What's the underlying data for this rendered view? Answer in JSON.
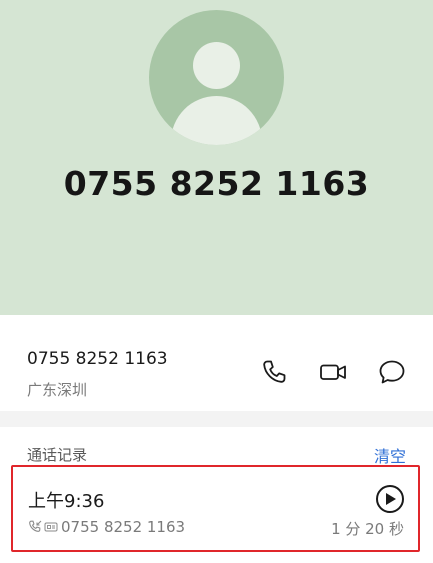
{
  "contact": {
    "number": "0755 8252 1163",
    "location": "广东深圳"
  },
  "actions": [
    {
      "label": "phone",
      "icon": "phone-icon"
    },
    {
      "label": "video",
      "icon": "video-call-icon"
    },
    {
      "label": "message",
      "icon": "message-icon"
    }
  ],
  "history": {
    "title": "通话记录",
    "clear_label": "清空",
    "records": [
      {
        "time": "上午9:36",
        "number": "0755 8252 1163",
        "duration": "1 分 20 秒"
      }
    ]
  },
  "colors": {
    "hero_background": "#d5e5d3",
    "avatar": "#a8c6a6",
    "accent": "#2f6fd6",
    "highlight_border": "#e0262b"
  }
}
